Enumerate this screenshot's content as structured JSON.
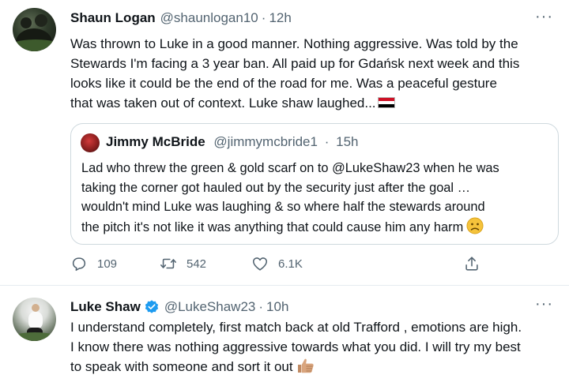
{
  "tweets": [
    {
      "author": {
        "name": "Shaun Logan",
        "handle": "@shaunlogan10",
        "time": "12h"
      },
      "separator": "·",
      "more": "···",
      "text_lines": [
        "Was thrown to Luke in a good manner. Nothing aggressive. Was told by the",
        "Stewards I'm facing a 3 year ban. All paid up for Gdańsk next week and this",
        "looks like it could be the end of the road for me. Was a peaceful gesture",
        "that was taken out of context. Luke shaw laughed..."
      ],
      "emoji": "egypt-flag",
      "quote": {
        "author": {
          "name": "Jimmy McBride",
          "handle": "@jimmymcbride1",
          "time": "15h"
        },
        "separator": "·",
        "text_lines": [
          "Lad who threw the green & gold scarf on to @LukeShaw23 when he was",
          "taking the corner got hauled out by the security just after the goal …",
          "wouldn't mind Luke was laughing & so where half the stewards around",
          "the pitch it's not like it was anything that could cause him any harm"
        ],
        "emoji": "sad-face"
      },
      "actions": {
        "replies": "109",
        "retweets": "542",
        "likes": "6.1K"
      }
    },
    {
      "author": {
        "name": "Luke Shaw",
        "handle": "@LukeShaw23",
        "time": "10h",
        "verified": true
      },
      "separator": "·",
      "more": "···",
      "text_lines": [
        "I understand completely, first match back at old Trafford , emotions are high.",
        "I know there was nothing aggressive towards what you did. I will try my best",
        "to speak with someone and sort it out"
      ],
      "emoji": "thumbs-up"
    }
  ],
  "colors": {
    "text": "#0f1419",
    "secondary": "#536471",
    "border": "#cfd9de",
    "verified": "#1d9bf0"
  }
}
